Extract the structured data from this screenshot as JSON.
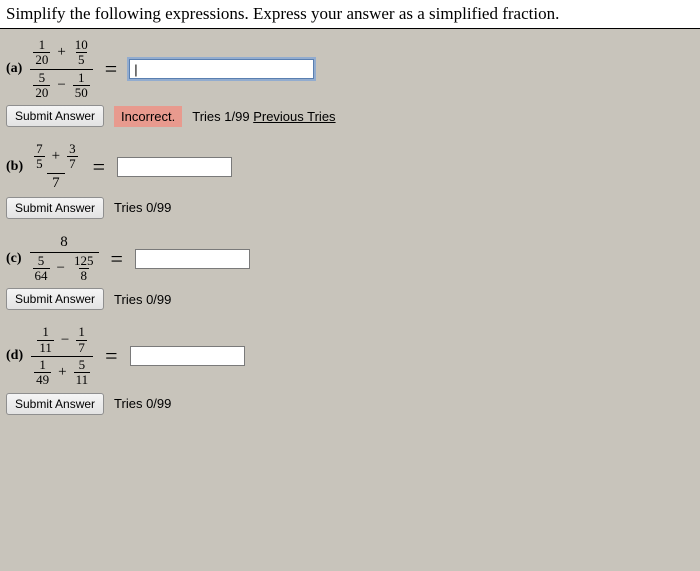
{
  "header": "Simplify the following expressions. Express your answer as a simplified fraction.",
  "problems": {
    "a": {
      "label": "(a)",
      "num_f1_n": "1",
      "num_f1_d": "20",
      "num_op": "+",
      "num_f2_n": "10",
      "num_f2_d": "5",
      "den_f1_n": "5",
      "den_f1_d": "20",
      "den_op": "−",
      "den_f2_n": "1",
      "den_f2_d": "50",
      "eq": "=",
      "input_value": "|",
      "submit": "Submit Answer",
      "status": "Incorrect.",
      "tries": "Tries 1/99",
      "prev": "Previous Tries"
    },
    "b": {
      "label": "(b)",
      "num_f1_n": "7",
      "num_f1_d": "5",
      "num_op": "+",
      "num_f2_n": "3",
      "num_f2_d": "7",
      "den_single": "7",
      "eq": "=",
      "submit": "Submit Answer",
      "tries": "Tries 0/99"
    },
    "c": {
      "label": "(c)",
      "num_single": "8",
      "den_f1_n": "5",
      "den_f1_d": "64",
      "den_op": "−",
      "den_f2_n": "125",
      "den_f2_d": "8",
      "eq": "=",
      "submit": "Submit Answer",
      "tries": "Tries 0/99"
    },
    "d": {
      "label": "(d)",
      "num_f1_n": "1",
      "num_f1_d": "11",
      "num_op": "−",
      "num_f2_n": "1",
      "num_f2_d": "7",
      "den_f1_n": "1",
      "den_f1_d": "49",
      "den_op": "+",
      "den_f2_n": "5",
      "den_f2_d": "11",
      "eq": "=",
      "submit": "Submit Answer",
      "tries": "Tries 0/99"
    }
  }
}
